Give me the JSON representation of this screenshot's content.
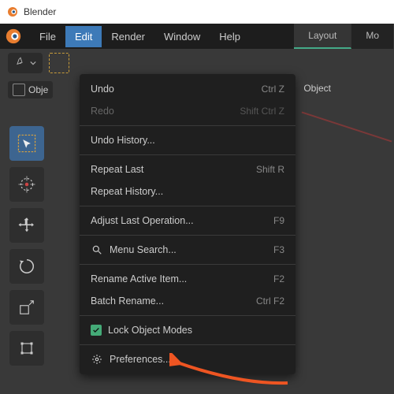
{
  "titlebar": {
    "app_name": "Blender"
  },
  "topmenu": {
    "file": "File",
    "edit": "Edit",
    "render": "Render",
    "window": "Window",
    "help": "Help"
  },
  "workspaces": {
    "layout": "Layout",
    "modeling": "Mo"
  },
  "modebar": {
    "object_mode": "Obje",
    "object_menu": "Object"
  },
  "edit_menu": {
    "undo": {
      "label": "Undo",
      "shortcut": "Ctrl Z"
    },
    "redo": {
      "label": "Redo",
      "shortcut": "Shift Ctrl Z"
    },
    "undo_history": {
      "label": "Undo History..."
    },
    "repeat_last": {
      "label": "Repeat Last",
      "shortcut": "Shift R"
    },
    "repeat_history": {
      "label": "Repeat History..."
    },
    "adjust_last": {
      "label": "Adjust Last Operation...",
      "shortcut": "F9"
    },
    "menu_search": {
      "label": "Menu Search...",
      "shortcut": "F3"
    },
    "rename_active": {
      "label": "Rename Active Item...",
      "shortcut": "F2"
    },
    "batch_rename": {
      "label": "Batch Rename...",
      "shortcut": "Ctrl F2"
    },
    "lock_modes": {
      "label": "Lock Object Modes"
    },
    "preferences": {
      "label": "Preferences..."
    }
  }
}
